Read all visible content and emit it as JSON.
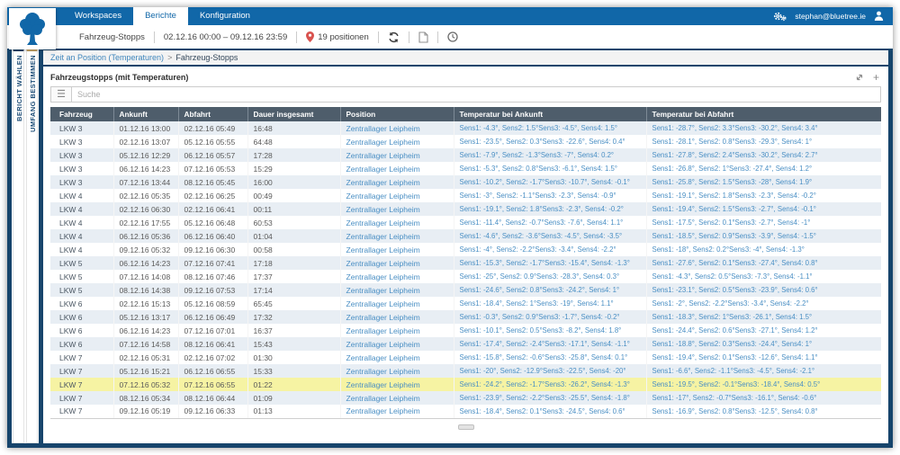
{
  "topbar": {
    "nav": [
      {
        "label": "Workspaces",
        "active": false
      },
      {
        "label": "Berichte",
        "active": true
      },
      {
        "label": "Konfiguration",
        "active": false
      }
    ],
    "user_email": "stephan@bluetree.ie"
  },
  "toolbar": {
    "report_name": "Fahrzeug-Stopps",
    "date_range": "02.12.16 00:00 – 09.12.16 23:59",
    "positions_label": "19 positionen"
  },
  "sidebar": {
    "tabs": [
      {
        "label": "BERICHT WÄHLEN"
      },
      {
        "label": "UMFANG BESTIMMEN"
      }
    ]
  },
  "breadcrumb": {
    "link": "Zeit an Position (Temperaturen)",
    "separator": ">",
    "current": "Fahrzeug-Stopps"
  },
  "panel": {
    "title": "Fahrzeugstopps (mit Temperaturen)"
  },
  "search": {
    "placeholder": "Suche"
  },
  "icons": {
    "topbar": [
      "cogs-icon",
      "user-icon"
    ],
    "toolbar": [
      "map-pin-icon",
      "refresh-icon",
      "export-document-icon",
      "clock-icon"
    ],
    "panel": [
      "expand-icon",
      "add-icon"
    ],
    "search": [
      "menu-icon"
    ],
    "logo": "bluetree-logo"
  },
  "colors": {
    "topbar_blue": "#1167a8",
    "frame_navy": "#17456c",
    "table_header_gray": "#4e5d6b",
    "row_alt": "#e8eef4",
    "row_highlight": "#f6f3a3",
    "link_blue": "#4a8fc4",
    "pin_red": "#d9534f",
    "tab_accent_tan": "#c7a768"
  },
  "table": {
    "columns": [
      "Fahrzeug",
      "Ankunft",
      "Abfahrt",
      "Dauer insgesamt",
      "Position",
      "Temperatur bei Ankunft",
      "Temperatur bei Abfahrt"
    ],
    "rows": [
      {
        "vehicle": "LKW 3",
        "arrival": "01.12.16 13:00",
        "departure": "02.12.16 05:49",
        "duration": "16:48",
        "position": "Zentrallager Leipheim",
        "temp_arrival": "Sens1: -4.3°, Sens2: 1.5°Sens3: -4.5°, Sens4: 1.5°",
        "temp_departure": "Sens1: -28.7°, Sens2: 3.3°Sens3: -30.2°, Sens4: 3.4°"
      },
      {
        "vehicle": "LKW 3",
        "arrival": "02.12.16 13:07",
        "departure": "05.12.16 05:55",
        "duration": "64:48",
        "position": "Zentrallager Leipheim",
        "temp_arrival": "Sens1: -23.5°, Sens2: 0.3°Sens3: -22.6°, Sens4: 0.4°",
        "temp_departure": "Sens1: -28.1°, Sens2: 0.8°Sens3: -29.3°, Sens4: 1°"
      },
      {
        "vehicle": "LKW 3",
        "arrival": "05.12.16 12:29",
        "departure": "06.12.16 05:57",
        "duration": "17:28",
        "position": "Zentrallager Leipheim",
        "temp_arrival": "Sens1: -7.9°, Sens2: -1.3°Sens3: -7°, Sens4: 0.2°",
        "temp_departure": "Sens1: -27.8°, Sens2: 2.4°Sens3: -30.2°, Sens4: 2.7°"
      },
      {
        "vehicle": "LKW 3",
        "arrival": "06.12.16 14:23",
        "departure": "07.12.16 05:53",
        "duration": "15:29",
        "position": "Zentrallager Leipheim",
        "temp_arrival": "Sens1: -5.3°, Sens2: 0.8°Sens3: -6.1°, Sens4: 1.5°",
        "temp_departure": "Sens1: -26.8°, Sens2: 1°Sens3: -27.4°, Sens4: 1.2°"
      },
      {
        "vehicle": "LKW 3",
        "arrival": "07.12.16 13:44",
        "departure": "08.12.16 05:45",
        "duration": "16:00",
        "position": "Zentrallager Leipheim",
        "temp_arrival": "Sens1: -10.2°, Sens2: -1.7°Sens3: -10.7°, Sens4: -0.1°",
        "temp_departure": "Sens1: -25.8°, Sens2: 1.5°Sens3: -28°, Sens4: 1.9°"
      },
      {
        "vehicle": "LKW 4",
        "arrival": "02.12.16 05:35",
        "departure": "02.12.16 06:25",
        "duration": "00:49",
        "position": "Zentrallager Leipheim",
        "temp_arrival": "Sens1: -3°, Sens2: -1.1°Sens3: -2.3°, Sens4: -0.9°",
        "temp_departure": "Sens1: -19.1°, Sens2: 1.8°Sens3: -2.3°, Sens4: -0.2°"
      },
      {
        "vehicle": "LKW 4",
        "arrival": "02.12.16 06:30",
        "departure": "02.12.16 06:41",
        "duration": "00:11",
        "position": "Zentrallager Leipheim",
        "temp_arrival": "Sens1: -19.1°, Sens2: 1.8°Sens3: -2.3°, Sens4: -0.2°",
        "temp_departure": "Sens1: -19.4°, Sens2: 1.5°Sens3: -2.7°, Sens4: -0.1°"
      },
      {
        "vehicle": "LKW 4",
        "arrival": "02.12.16 17:55",
        "departure": "05.12.16 06:48",
        "duration": "60:53",
        "position": "Zentrallager Leipheim",
        "temp_arrival": "Sens1: -11.4°, Sens2: -0.7°Sens3: -7.6°, Sens4: 1.1°",
        "temp_departure": "Sens1: -17.5°, Sens2: 0.1°Sens3: -2.7°, Sens4: -1°"
      },
      {
        "vehicle": "LKW 4",
        "arrival": "06.12.16 05:36",
        "departure": "06.12.16 06:40",
        "duration": "01:04",
        "position": "Zentrallager Leipheim",
        "temp_arrival": "Sens1: -4.6°, Sens2: -3.6°Sens3: -4.5°, Sens4: -3.5°",
        "temp_departure": "Sens1: -18.5°, Sens2: 0.9°Sens3: -3.9°, Sens4: -1.5°"
      },
      {
        "vehicle": "LKW 4",
        "arrival": "09.12.16 05:32",
        "departure": "09.12.16 06:30",
        "duration": "00:58",
        "position": "Zentrallager Leipheim",
        "temp_arrival": "Sens1: -4°, Sens2: -2.2°Sens3: -3.4°, Sens4: -2.2°",
        "temp_departure": "Sens1: -18°, Sens2: 0.2°Sens3: -4°, Sens4: -1.3°"
      },
      {
        "vehicle": "LKW 5",
        "arrival": "06.12.16 14:23",
        "departure": "07.12.16 07:41",
        "duration": "17:18",
        "position": "Zentrallager Leipheim",
        "temp_arrival": "Sens1: -15.3°, Sens2: -1.7°Sens3: -15.4°, Sens4: -1.3°",
        "temp_departure": "Sens1: -27.6°, Sens2: 0.1°Sens3: -27.4°, Sens4: 0.8°"
      },
      {
        "vehicle": "LKW 5",
        "arrival": "07.12.16 14:08",
        "departure": "08.12.16 07:46",
        "duration": "17:37",
        "position": "Zentrallager Leipheim",
        "temp_arrival": "Sens1: -25°, Sens2: 0.9°Sens3: -28.3°, Sens4: 0.3°",
        "temp_departure": "Sens1: -4.3°, Sens2: 0.5°Sens3: -7.3°, Sens4: -1.1°"
      },
      {
        "vehicle": "LKW 5",
        "arrival": "08.12.16 14:38",
        "departure": "09.12.16 07:53",
        "duration": "17:14",
        "position": "Zentrallager Leipheim",
        "temp_arrival": "Sens1: -24.6°, Sens2: 0.8°Sens3: -24.2°, Sens4: 1°",
        "temp_departure": "Sens1: -23.1°, Sens2: 0.5°Sens3: -23.9°, Sens4: 0.6°"
      },
      {
        "vehicle": "LKW 6",
        "arrival": "02.12.16 15:13",
        "departure": "05.12.16 08:59",
        "duration": "65:45",
        "position": "Zentrallager Leipheim",
        "temp_arrival": "Sens1: -18.4°, Sens2: 1°Sens3: -19°, Sens4: 1.1°",
        "temp_departure": "Sens1: -2°, Sens2: -2.2°Sens3: -3.4°, Sens4: -2.2°"
      },
      {
        "vehicle": "LKW 6",
        "arrival": "05.12.16 13:17",
        "departure": "06.12.16 06:49",
        "duration": "17:32",
        "position": "Zentrallager Leipheim",
        "temp_arrival": "Sens1: -0.3°, Sens2: 0.9°Sens3: -1.7°, Sens4: -0.2°",
        "temp_departure": "Sens1: -18.3°, Sens2: 1°Sens3: -26.1°, Sens4: 1.5°"
      },
      {
        "vehicle": "LKW 6",
        "arrival": "06.12.16 14:23",
        "departure": "07.12.16 07:01",
        "duration": "16:37",
        "position": "Zentrallager Leipheim",
        "temp_arrival": "Sens1: -10.1°, Sens2: 0.5°Sens3: -8.2°, Sens4: 1.8°",
        "temp_departure": "Sens1: -24.4°, Sens2: 0.6°Sens3: -27.1°, Sens4: 1.2°"
      },
      {
        "vehicle": "LKW 6",
        "arrival": "07.12.16 14:58",
        "departure": "08.12.16 06:41",
        "duration": "15:43",
        "position": "Zentrallager Leipheim",
        "temp_arrival": "Sens1: -17.4°, Sens2: -2.4°Sens3: -17.1°, Sens4: -1.1°",
        "temp_departure": "Sens1: -18.8°, Sens2: 0.3°Sens3: -24.4°, Sens4: 1°"
      },
      {
        "vehicle": "LKW 7",
        "arrival": "02.12.16 05:31",
        "departure": "02.12.16 07:02",
        "duration": "01:30",
        "position": "Zentrallager Leipheim",
        "temp_arrival": "Sens1: -15.8°, Sens2: -0.6°Sens3: -25.8°, Sens4: 0.1°",
        "temp_departure": "Sens1: -19.4°, Sens2: 0.1°Sens3: -12.6°, Sens4: 1.1°"
      },
      {
        "vehicle": "LKW 7",
        "arrival": "05.12.16 15:21",
        "departure": "06.12.16 06:55",
        "duration": "15:33",
        "position": "Zentrallager Leipheim",
        "temp_arrival": "Sens1: -20°, Sens2: -12.9°Sens3: -22.5°, Sens4: -20°",
        "temp_departure": "Sens1: -6.6°, Sens2: -1.1°Sens3: -4.5°, Sens4: -2.1°"
      },
      {
        "vehicle": "LKW 7",
        "arrival": "07.12.16 05:32",
        "departure": "07.12.16 06:55",
        "duration": "01:22",
        "position": "Zentrallager Leipheim",
        "temp_arrival": "Sens1: -24.2°, Sens2: -1.7°Sens3: -26.2°, Sens4: -1.3°",
        "temp_departure": "Sens1: -19.5°, Sens2: -0.1°Sens3: -18.4°, Sens4: 0.5°",
        "highlight": true
      },
      {
        "vehicle": "LKW 7",
        "arrival": "08.12.16 05:34",
        "departure": "08.12.16 06:44",
        "duration": "01:09",
        "position": "Zentrallager Leipheim",
        "temp_arrival": "Sens1: -23.9°, Sens2: -2.2°Sens3: -25.5°, Sens4: -1.8°",
        "temp_departure": "Sens1: -17°, Sens2: -0.7°Sens3: -16.1°, Sens4: -0.6°"
      },
      {
        "vehicle": "LKW 7",
        "arrival": "09.12.16 05:19",
        "departure": "09.12.16 06:33",
        "duration": "01:13",
        "position": "Zentrallager Leipheim",
        "temp_arrival": "Sens1: -18.4°, Sens2: 0.1°Sens3: -24.5°, Sens4: 0.6°",
        "temp_departure": "Sens1: -16.9°, Sens2: 0.8°Sens3: -12.5°, Sens4: 0.8°"
      }
    ]
  }
}
